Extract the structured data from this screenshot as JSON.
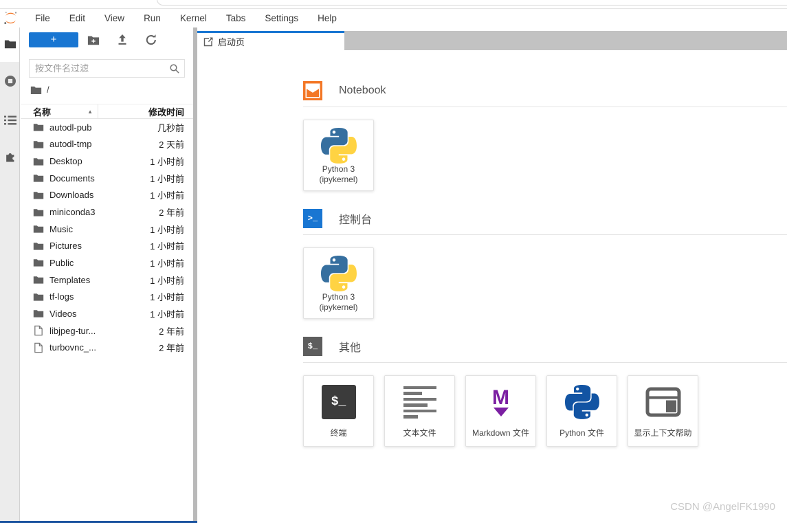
{
  "menu": {
    "items": [
      "File",
      "Edit",
      "View",
      "Run",
      "Kernel",
      "Tabs",
      "Settings",
      "Help"
    ]
  },
  "activity_bar": {
    "icons": [
      "file-browser-icon",
      "running-kernels-icon",
      "table-of-contents-icon",
      "extension-manager-icon"
    ]
  },
  "file_browser": {
    "new_button_label": "+",
    "toolbar_icons": [
      "new-folder-icon",
      "upload-icon",
      "refresh-icon"
    ],
    "search_placeholder": "按文件名过滤",
    "search_icon": "magnifier",
    "breadcrumb_root": "/",
    "sort_caret": "▲",
    "columns": {
      "name": "名称",
      "modified": "修改时间"
    },
    "rows": [
      {
        "name": "autodl-pub",
        "time": "几秒前",
        "type": "folder"
      },
      {
        "name": "autodl-tmp",
        "time": "2 天前",
        "type": "folder"
      },
      {
        "name": "Desktop",
        "time": "1 小时前",
        "type": "folder"
      },
      {
        "name": "Documents",
        "time": "1 小时前",
        "type": "folder"
      },
      {
        "name": "Downloads",
        "time": "1 小时前",
        "type": "folder"
      },
      {
        "name": "miniconda3",
        "time": "2 年前",
        "type": "folder"
      },
      {
        "name": "Music",
        "time": "1 小时前",
        "type": "folder"
      },
      {
        "name": "Pictures",
        "time": "1 小时前",
        "type": "folder"
      },
      {
        "name": "Public",
        "time": "1 小时前",
        "type": "folder"
      },
      {
        "name": "Templates",
        "time": "1 小时前",
        "type": "folder"
      },
      {
        "name": "tf-logs",
        "time": "1 小时前",
        "type": "folder"
      },
      {
        "name": "Videos",
        "time": "1 小时前",
        "type": "folder"
      },
      {
        "name": "libjpeg-tur...",
        "time": "2 年前",
        "type": "file"
      },
      {
        "name": "turbovnc_...",
        "time": "2 年前",
        "type": "file"
      }
    ]
  },
  "tab": {
    "label": "启动页",
    "icon": "launcher-icon"
  },
  "launcher": {
    "sections": [
      {
        "title": "Notebook",
        "icon": "notebook-icon"
      },
      {
        "title": "控制台",
        "icon": "console-icon",
        "icon_glyph": ">_"
      },
      {
        "title": "其他",
        "icon": "terminal-icon",
        "icon_glyph": "$_"
      }
    ],
    "kernel_card": {
      "line1": "Python 3",
      "line2": "(ipykernel)"
    },
    "other_cards": [
      {
        "label": "终端",
        "icon": "terminal-icon",
        "glyph": "$_"
      },
      {
        "label": "文本文件",
        "icon": "text-file-icon"
      },
      {
        "label": "Markdown 文件",
        "icon": "markdown-icon",
        "glyph": "M"
      },
      {
        "label": "Python 文件",
        "icon": "python-file-icon"
      },
      {
        "label": "显示上下文帮助",
        "icon": "contextual-help-icon"
      }
    ]
  },
  "watermark": "CSDN @AngelFK1990",
  "colors": {
    "accent_blue": "#1976d2",
    "jupyter_orange": "#f37726",
    "markdown_purple": "#7b1fa2",
    "python_blue": "#366f9f",
    "python_yellow": "#ffd343",
    "python_file_blue": "#1254a3",
    "tabbar_gray": "#c2c2c2",
    "icon_gray": "#616161"
  }
}
